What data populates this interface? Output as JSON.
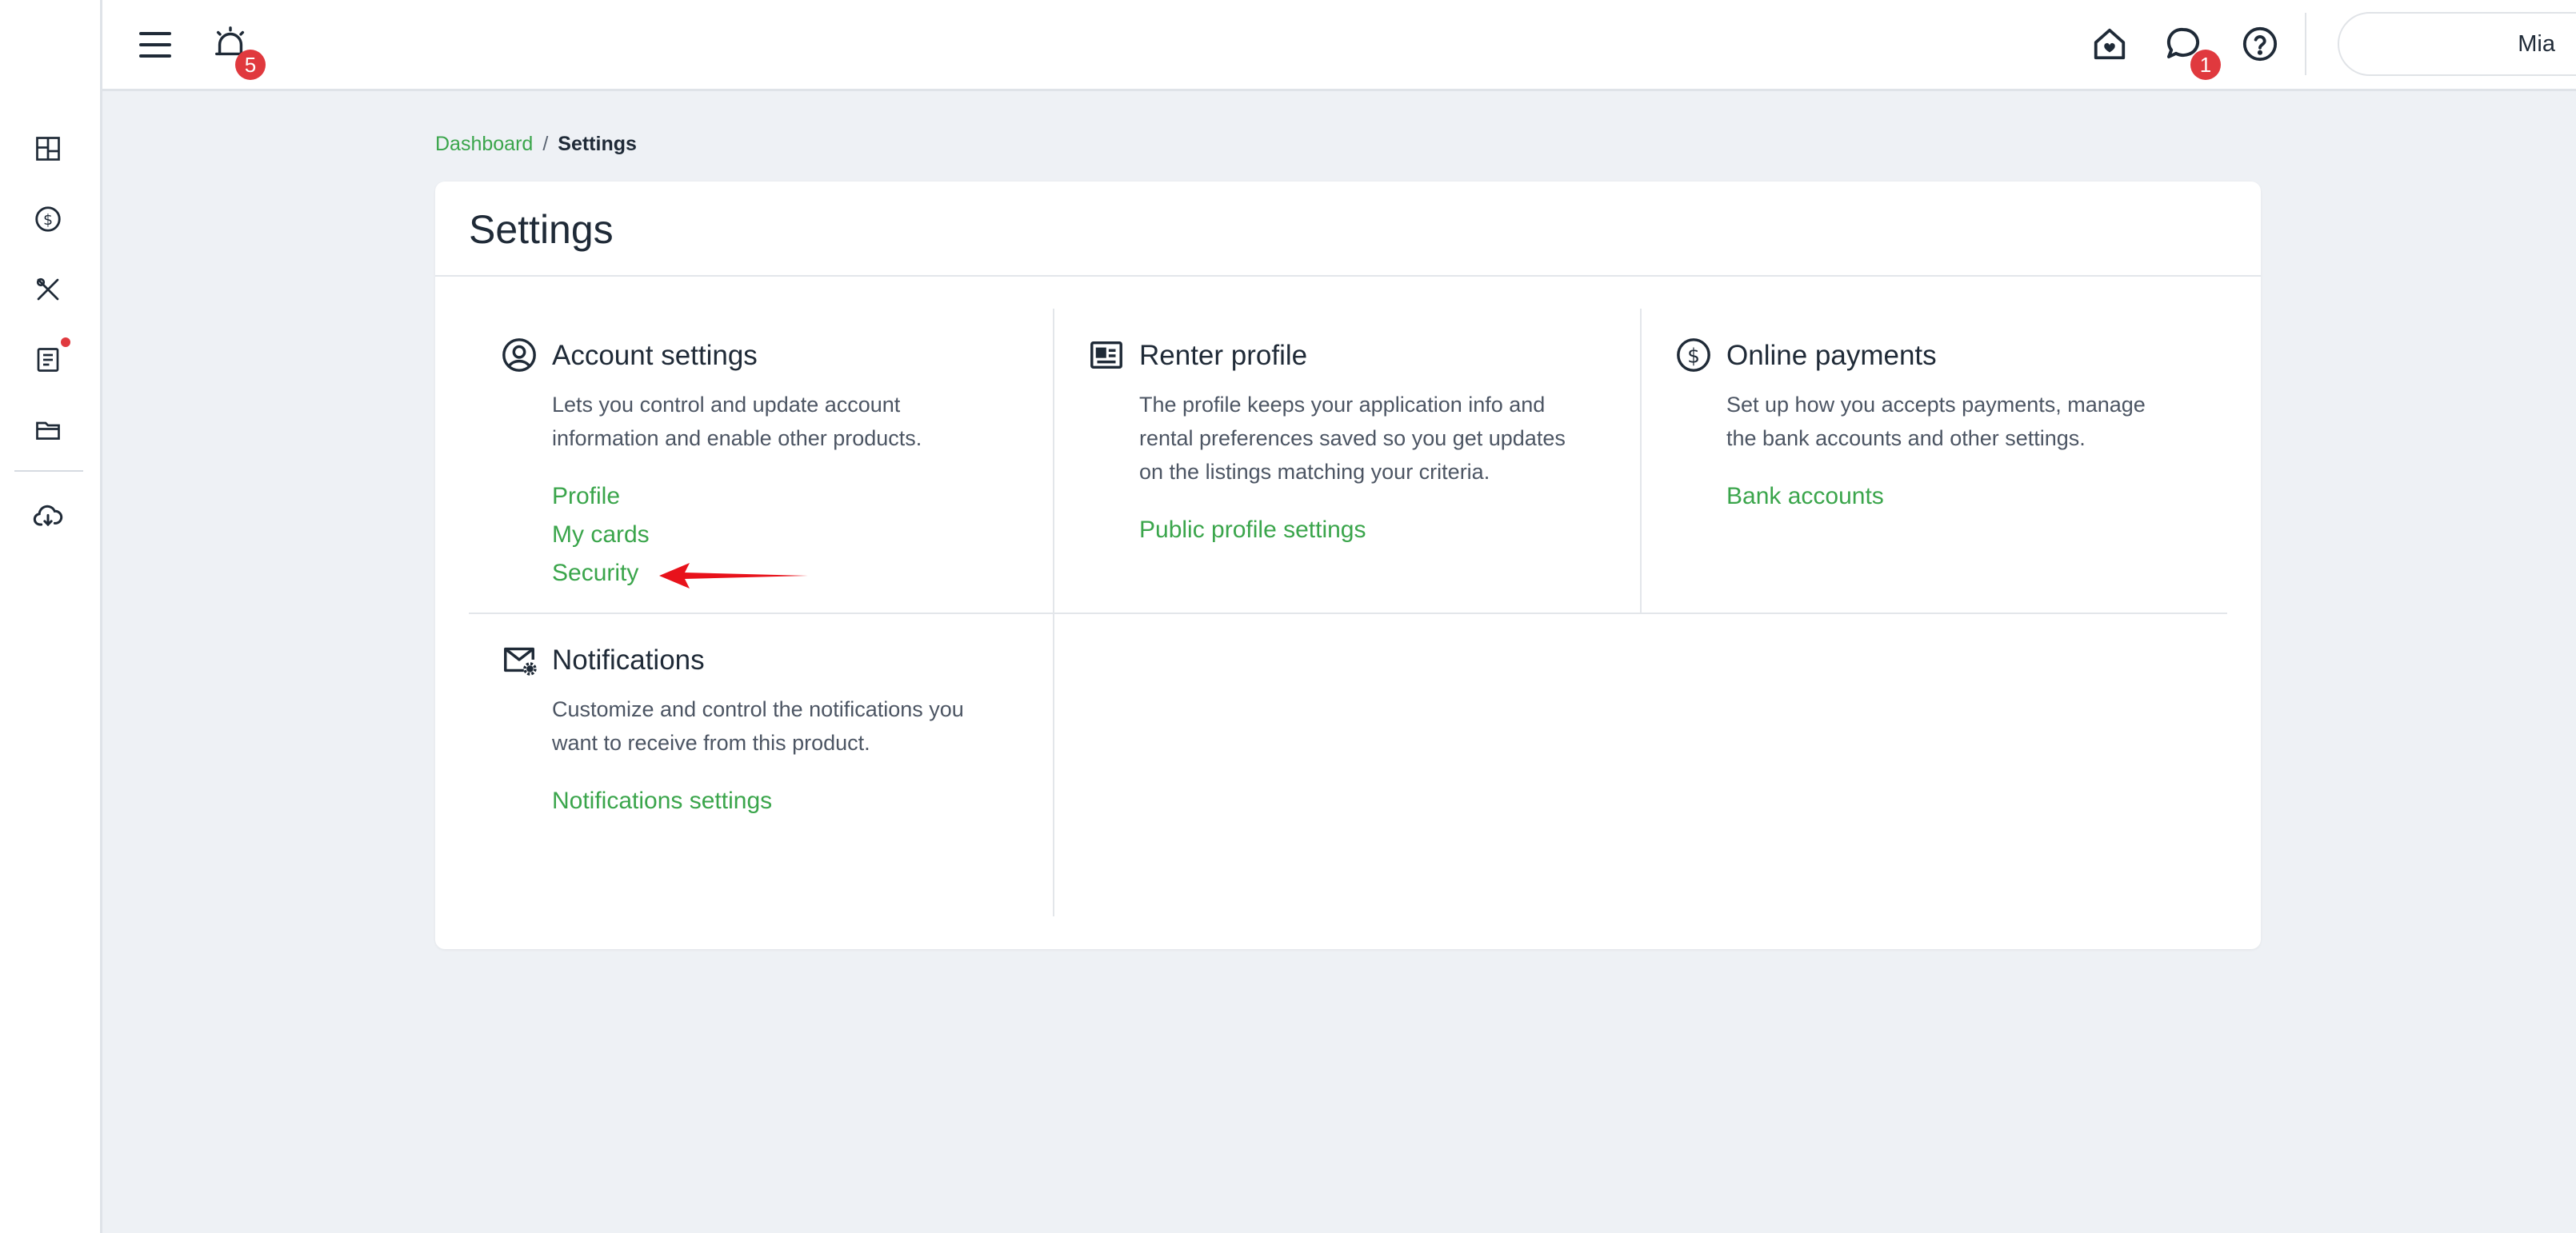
{
  "topbar": {
    "alarm_badge": "5",
    "messages_badge": "1",
    "user_name": "Mia"
  },
  "sidebar": {
    "items": [
      {
        "icon": "dashboard-icon"
      },
      {
        "icon": "payments-icon"
      },
      {
        "icon": "tools-icon"
      },
      {
        "icon": "documents-icon"
      },
      {
        "icon": "folder-icon"
      },
      {
        "icon": "cloud-download-icon"
      }
    ]
  },
  "breadcrumb": {
    "parent": "Dashboard",
    "separator": "/",
    "current": "Settings"
  },
  "page": {
    "title": "Settings"
  },
  "sections": {
    "account": {
      "title": "Account settings",
      "description": "Lets you control and update account information and enable other products.",
      "links": [
        "Profile",
        "My cards",
        "Security"
      ]
    },
    "renter": {
      "title": "Renter profile",
      "description": "The profile keeps your application info and rental preferences saved so you get updates on the listings matching your criteria.",
      "links": [
        "Public profile settings"
      ]
    },
    "payments": {
      "title": "Online payments",
      "description": "Set up how you accepts payments, manage the bank accounts and other settings.",
      "links": [
        "Bank accounts"
      ]
    },
    "notifications": {
      "title": "Notifications",
      "description": "Customize and control the notifications you want to receive from this product.",
      "links": [
        "Notifications settings"
      ]
    }
  },
  "colors": {
    "accent_green": "#3aa54b",
    "badge_red": "#e0393e",
    "annotation_arrow": "#e8121b",
    "page_bg": "#eef1f5"
  }
}
